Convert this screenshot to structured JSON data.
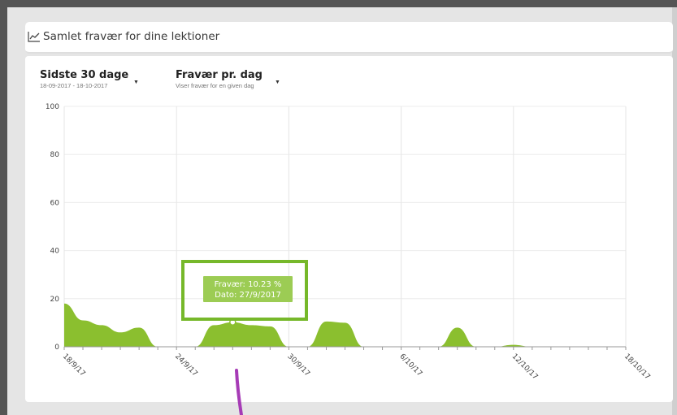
{
  "header": {
    "title": "Samlet fravær for dine lektioner",
    "icon": "line-chart-icon"
  },
  "controls": {
    "period": {
      "label": "Sidste 30 dage",
      "sub": "18-09-2017 - 18-10-2017"
    },
    "mode": {
      "label": "Fravær pr. dag",
      "sub": "Viser fravær for en given dag"
    }
  },
  "tooltip": {
    "line1": "Fravær: 10.23 %",
    "line2": "Dato: 27/9/2017"
  },
  "colors": {
    "area_fill": "#8bbf2f",
    "tooltip_bg": "#9ccc54",
    "highlight_border": "#76b82a",
    "annotation": "#a63bb6",
    "frame": "#555555"
  },
  "chart_data": {
    "type": "area",
    "title": "",
    "xlabel": "",
    "ylabel": "",
    "ylim": [
      0,
      100
    ],
    "yticks": [
      "0",
      "20",
      "40",
      "60",
      "80",
      "100"
    ],
    "xticks": [
      "18/9/17",
      "24/9/17",
      "30/9/17",
      "6/10/17",
      "12/10/17",
      "18/10/17"
    ],
    "x": [
      "18/9/2017",
      "19/9/2017",
      "20/9/2017",
      "21/9/2017",
      "22/9/2017",
      "23/9/2017",
      "24/9/2017",
      "25/9/2017",
      "26/9/2017",
      "27/9/2017",
      "28/9/2017",
      "29/9/2017",
      "30/9/2017",
      "1/10/2017",
      "2/10/2017",
      "3/10/2017",
      "4/10/2017",
      "5/10/2017",
      "6/10/2017",
      "7/10/2017",
      "8/10/2017",
      "9/10/2017",
      "10/10/2017",
      "11/10/2017",
      "12/10/2017",
      "13/10/2017",
      "14/10/2017",
      "15/10/2017",
      "16/10/2017",
      "17/10/2017",
      "18/10/2017"
    ],
    "series": [
      {
        "values": [
          18,
          11,
          9,
          6,
          8,
          0,
          0,
          0,
          9,
          10.23,
          9,
          8.5,
          0,
          0,
          10.5,
          10,
          0,
          0,
          0,
          0,
          0,
          8,
          0,
          0,
          0.8,
          0,
          0,
          0,
          0,
          0,
          0
        ]
      }
    ],
    "grid": true
  }
}
